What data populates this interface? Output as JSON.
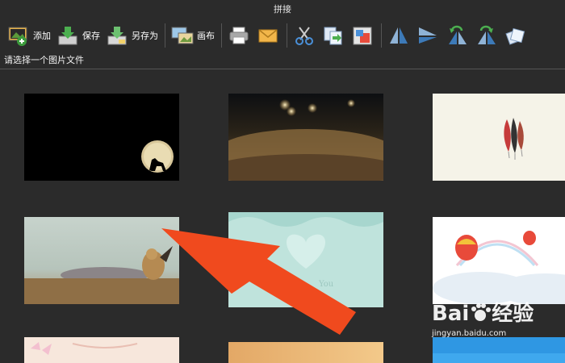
{
  "window": {
    "title": "拼接"
  },
  "toolbar": {
    "add_label": "添加",
    "save_label": "保存",
    "save_as_label": "另存为",
    "canvas_label": "画布"
  },
  "status": {
    "prompt": "请选择一个图片文件"
  },
  "watermark": {
    "brand_parts": [
      "Bai",
      "经验"
    ],
    "url": "jingyan.baidu.com"
  },
  "colors": {
    "background": "#2b2b2b",
    "arrow": "#f04a1e",
    "text": "#ffffff"
  },
  "icons": [
    "add-image-icon",
    "save-icon",
    "save-as-icon",
    "canvas-icon",
    "print-icon",
    "mail-icon",
    "cut-icon",
    "copy-icon",
    "paste-icon",
    "flip-horizontal-icon",
    "flip-vertical-icon",
    "rotate-left-icon",
    "rotate-right-icon",
    "rotate-icon"
  ]
}
